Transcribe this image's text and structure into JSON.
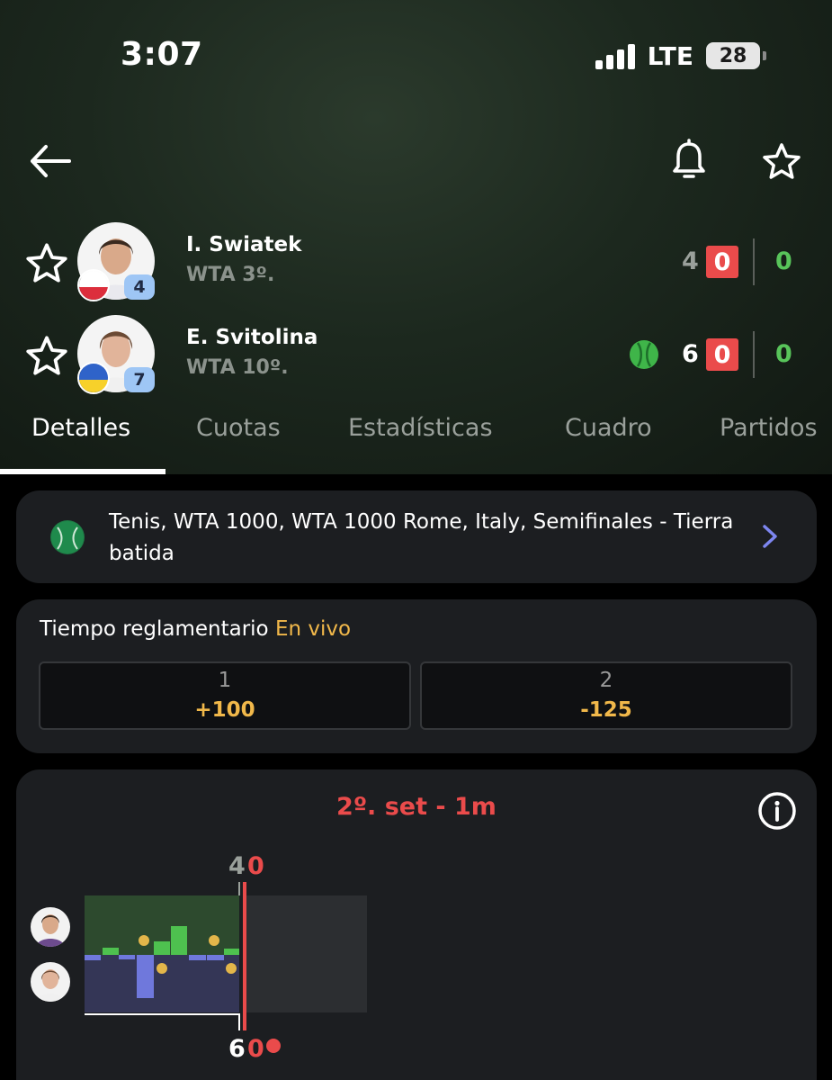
{
  "status_bar": {
    "time": "3:07",
    "network": "LTE",
    "battery": "28"
  },
  "header_icons": [
    "back-arrow-icon",
    "bell-icon",
    "star-icon"
  ],
  "players": [
    {
      "name": "I. Swiatek",
      "rank": "WTA 3º.",
      "seed": "4",
      "flag": "poland",
      "games": "4",
      "point": "0",
      "sets": "0",
      "serving": false
    },
    {
      "name": "E. Svitolina",
      "rank": "WTA 10º.",
      "seed": "7",
      "flag": "ukraine",
      "games": "6",
      "point": "0",
      "sets": "0",
      "serving": true
    }
  ],
  "tabs": [
    {
      "label": "Detalles",
      "active": true
    },
    {
      "label": "Cuotas",
      "active": false
    },
    {
      "label": "Estadísticas",
      "active": false
    },
    {
      "label": "Cuadro",
      "active": false
    },
    {
      "label": "Partidos",
      "active": false
    }
  ],
  "competition": {
    "text": "Tenis, WTA 1000, WTA 1000 Rome, Italy, Semifinales - Tierra batida"
  },
  "odds": {
    "title": "Tiempo reglamentario",
    "live": "En vivo",
    "options": [
      {
        "label": "1",
        "value": "+100"
      },
      {
        "label": "2",
        "value": "-125"
      }
    ]
  },
  "momentum": {
    "title": "2º. set - 1m",
    "top_score": {
      "games": "4",
      "point": "0"
    },
    "bottom_score": {
      "games": "6",
      "point": "0"
    }
  },
  "colors": {
    "accent_red": "#ea4b4b",
    "set_green": "#58c45a",
    "odds_gold": "#f1b84a",
    "momentum_p1": "#4ec14f",
    "momentum_p2": "#6f78dc"
  }
}
